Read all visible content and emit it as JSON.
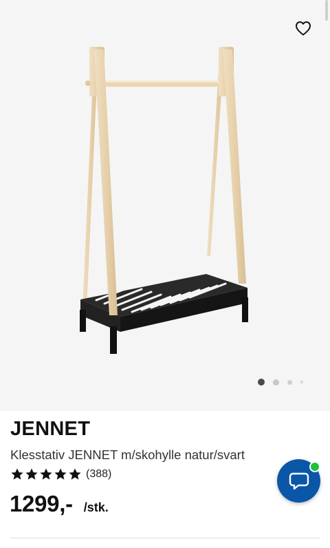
{
  "gallery": {
    "favorite_icon": "heart-outline-icon",
    "image_alt": "Klesstativ JENNET m/skohylle natur/svart",
    "carousel": {
      "count": 4,
      "active_index": 0
    }
  },
  "product": {
    "name": "JENNET",
    "description": "Klesstativ JENNET m/skohylle natur/svart",
    "rating": {
      "stars": 5,
      "max": 5,
      "count_label": "(388)"
    },
    "price": "1299,-",
    "price_unit": "/stk."
  },
  "chat": {
    "icon": "chat-bubble-icon",
    "status_color": "#1fbf3a",
    "color": "#0a57a8"
  },
  "colors": {
    "gallery_bg": "#f5f5f5",
    "wood": "#e8d3b0",
    "shelf": "#1c1c1c"
  }
}
